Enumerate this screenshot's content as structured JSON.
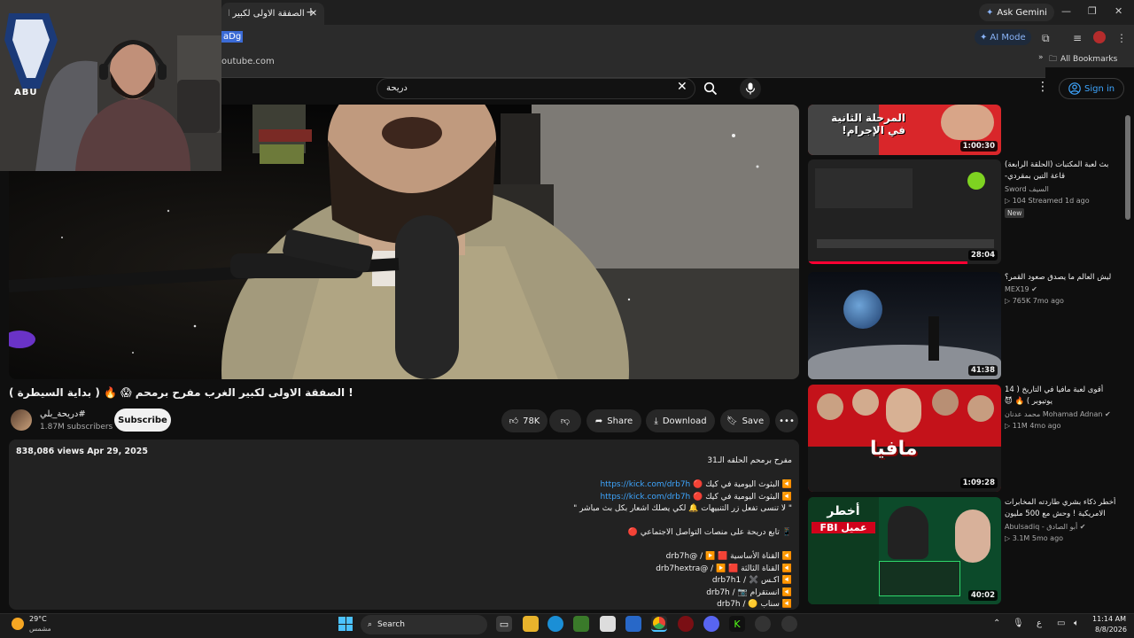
{
  "browser": {
    "tab_title": "الصفقة الاولى لكبير ا",
    "new_tab_symbol": "+",
    "ask_gemini": "Ask Gemini",
    "url_selected": "aDg",
    "url_suggestion": "outube.com",
    "ai_mode": "AI Mode",
    "all_bookmarks": "All Bookmarks"
  },
  "youtube_header": {
    "search_query": "دريحة",
    "sign_in": "Sign in"
  },
  "video": {
    "title": "! الصفقة الاولى لكبير الغرب مفرح برمحم 😱 🔥 ( بداية السيطرة )",
    "channel_name": "دريحة_بلي#",
    "subscribers": "1.87M subscribers",
    "subscribe": "Subscribe",
    "likes": "78K",
    "share": "Share",
    "download": "Download",
    "save": "Save"
  },
  "description": {
    "stats": "838,086 views  Apr 29, 2025",
    "lines": [
      {
        "text": "مفرح برمحم الحلقه الـ31"
      },
      {
        "text": ""
      },
      {
        "prefix": "◀️ البثوث اليومية في كيك 🔴 ",
        "link": "https://kick.com/drb7h"
      },
      {
        "prefix": "◀️ البثوث اليومية في كيك 🔴 ",
        "link": "https://kick.com/drb7h"
      },
      {
        "text": "\" لا تنسى تفعل زر التنبيهات 🔔 لكي يصلك اشعار بكل بث مباشر \""
      },
      {
        "text": ""
      },
      {
        "text": "📱 تابع دريحة على منصات التواصل الاجتماعي 🔴"
      },
      {
        "text": ""
      },
      {
        "text": "     ◀️ القناة الأساسية 🟥 ▶️ / @drb7h"
      },
      {
        "text": "     ◀️ القناة الثالثة 🟥 ▶️ / @drb7hextra"
      },
      {
        "text": "   ◀️ اكـس ✖️ / drb7h1"
      },
      {
        "text": "   ◀️ انستقرام 📷 / drb7h"
      },
      {
        "text": "   ◀️ سناب 🟡 / drb7h"
      }
    ]
  },
  "recommendations": [
    {
      "title": "",
      "channel": "",
      "meta": "",
      "duration": "1:00:30",
      "badge": ""
    },
    {
      "title": "بث لعبة المكتبات (الحلقة الرابعة) قاعة التين بمقردي-",
      "channel": "Sword السيف",
      "meta": "▷ 104  Streamed 1d ago",
      "duration": "28:04",
      "badge": "New"
    },
    {
      "title": "ليش العالم ما يصدق صعود القمر؟",
      "channel": "MEX19 ✔",
      "meta": "▷ 765K  7mo ago",
      "duration": "41:38",
      "badge": ""
    },
    {
      "title": "أقوى لعبة مافيا في التاريخ ( 14 يوتيوبر ) 🔥 😈",
      "channel": "محمد عدنان Mohamad Adnan ✔",
      "meta": "▷ 11M  4mo ago",
      "duration": "1:09:28",
      "badge": ""
    },
    {
      "title": "أخطر ذكاء بشري طاردته المخابرات الامريكية ! وحش مع 500 مليون دولار",
      "channel": "Abulsadiq - أبو الصادق ✔",
      "meta": "▷ 3.1M  5mo ago",
      "duration": "40:02",
      "badge": ""
    }
  ],
  "thumb_texts": {
    "rec1": "المرحلة الثانية في الإجرام!",
    "rec4": "مافيا",
    "rec5_top": "أخطر",
    "rec5_bottom": "عميل FBI"
  },
  "webcam": {
    "logo_text": "ABU"
  },
  "taskbar": {
    "weather_temp": "29°C",
    "weather_desc": "مشمس",
    "search": "Search",
    "time": "11:14 AM",
    "date": "8/8/2026",
    "lang": "ع"
  },
  "colors": {
    "accent": "#3ea6ff",
    "background": "#0f0f0f",
    "chrome": "#2b2b2b"
  }
}
